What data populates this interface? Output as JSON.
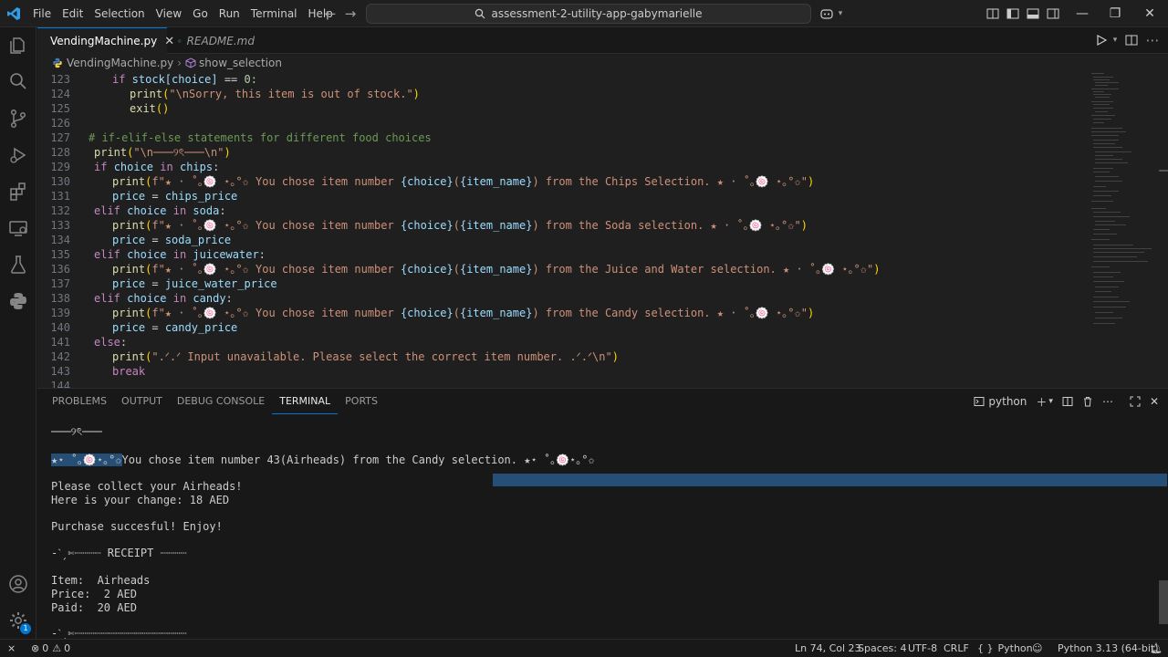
{
  "menu": [
    "File",
    "Edit",
    "Selection",
    "View",
    "Go",
    "Run",
    "Terminal",
    "Help"
  ],
  "search": {
    "text": "assessment-2-utility-app-gabymarielle"
  },
  "tabs": [
    {
      "label": "VendingMachine.py",
      "active": true
    },
    {
      "label": "README.md",
      "active": false
    }
  ],
  "breadcrumb": {
    "file": "VendingMachine.py",
    "symbol": "show_selection"
  },
  "code_lines": [
    {
      "n": "123"
    },
    {
      "n": "124"
    },
    {
      "n": "125"
    },
    {
      "n": "126"
    },
    {
      "n": "127"
    },
    {
      "n": "128"
    },
    {
      "n": "129"
    },
    {
      "n": "130"
    },
    {
      "n": "131"
    },
    {
      "n": "132"
    },
    {
      "n": "133"
    },
    {
      "n": "134"
    },
    {
      "n": "135"
    },
    {
      "n": "136"
    },
    {
      "n": "137"
    },
    {
      "n": "138"
    },
    {
      "n": "139"
    },
    {
      "n": "140"
    },
    {
      "n": "141"
    },
    {
      "n": "142"
    },
    {
      "n": "143"
    },
    {
      "n": "144"
    }
  ],
  "code": {
    "l123": [
      "if",
      " stock[choice] ",
      "==",
      " 0:"
    ],
    "l124": [
      "print",
      "(",
      "\"\\nSorry, this item is out of stock.\"",
      ")"
    ],
    "l125": [
      "exit",
      "()"
    ],
    "l127": "# if-elif-else statements for different food choices",
    "l128": [
      "print",
      "(",
      "\"\\n───୨ৎ───\\n\"",
      ")"
    ],
    "l129": [
      "if",
      "choice",
      "in",
      "chips",
      ":"
    ],
    "l130": [
      "print",
      "(",
      "f\"★ · ˚｡🍥 ⋆｡°✩ You chose item number ",
      "{choice}",
      "(",
      "{item_name}",
      ") from the Chips Selection. ★ · ˚｡🍥 ⋆｡°✩\"",
      ")"
    ],
    "l131": [
      "price",
      " = ",
      "chips_price"
    ],
    "l132": [
      "elif",
      "choice",
      "in",
      "soda",
      ":"
    ],
    "l133": [
      "print",
      "(",
      "f\"★ · ˚｡🍥 ⋆｡°✩ You chose item number ",
      "{choice}",
      "(",
      "{item_name}",
      ") from the Soda selection. ★ · ˚｡🍥 ⋆｡°✩\"",
      ")"
    ],
    "l134": [
      "price",
      " = ",
      "soda_price"
    ],
    "l135": [
      "elif",
      "choice",
      "in",
      "juicewater",
      ":"
    ],
    "l136": [
      "print",
      "(",
      "f\"★ · ˚｡🍥 ⋆｡°✩ You chose item number ",
      "{choice}",
      "(",
      "{item_name}",
      ") from the Juice and Water selection. ★ · ˚｡🍥 ⋆｡°✩\"",
      ")"
    ],
    "l137": [
      "price",
      " = ",
      "juice_water_price"
    ],
    "l138": [
      "elif",
      "choice",
      "in",
      "candy",
      ":"
    ],
    "l139": [
      "print",
      "(",
      "f\"★ · ˚｡🍥 ⋆｡°✩ You chose item number ",
      "{choice}",
      "(",
      "{item_name}",
      ") from the Candy selection. ★ · ˚｡🍥 ⋆｡°✩\"",
      ")"
    ],
    "l140": [
      "price",
      " = ",
      "candy_price"
    ],
    "l141": [
      "else",
      ":"
    ],
    "l142": [
      "print",
      "(",
      "\".ᐟ.ᐟ Input unavailable. Please select the correct item number. .ᐟ.ᐟ\\n\"",
      ")"
    ],
    "l143": "break"
  },
  "panel": {
    "tabs": [
      "PROBLEMS",
      "OUTPUT",
      "DEBUG CONSOLE",
      "TERMINAL",
      "PORTS"
    ],
    "shell": "python"
  },
  "terminal_lines": [
    "───୨ৎ───",
    "",
    "★⋆ ˚｡🍥⋆｡°✩",
    "You chose item number 43(Airheads) from the Candy selection. ★⋆ ˚｡🍥⋆｡°✩",
    "Please collect your Airheads!",
    "Here is your change: 18 AED",
    "Purchase succesful! Enjoy!",
    "-ˋˏ✄┈┈┈┈ RECEIPT ┈┈┈┈",
    "Item:  Airheads",
    "Price:  2 AED",
    "Paid:  20 AED",
    "-ˋˏ✄┈┈┈┈┈┈┈┈┈┈┈┈┈┈┈┈┈"
  ],
  "status": {
    "errors": "0",
    "warnings": "0",
    "position": "Ln 74, Col 23",
    "spaces": "Spaces: 4",
    "encoding": "UTF-8",
    "eol": "CRLF",
    "language": "Python",
    "interpreter": "Python 3.13 (64-bit)",
    "notif_count": "1"
  },
  "colors": {
    "accent": "#0078d4",
    "selection": "#264f78",
    "background": "#1f1f1f"
  }
}
